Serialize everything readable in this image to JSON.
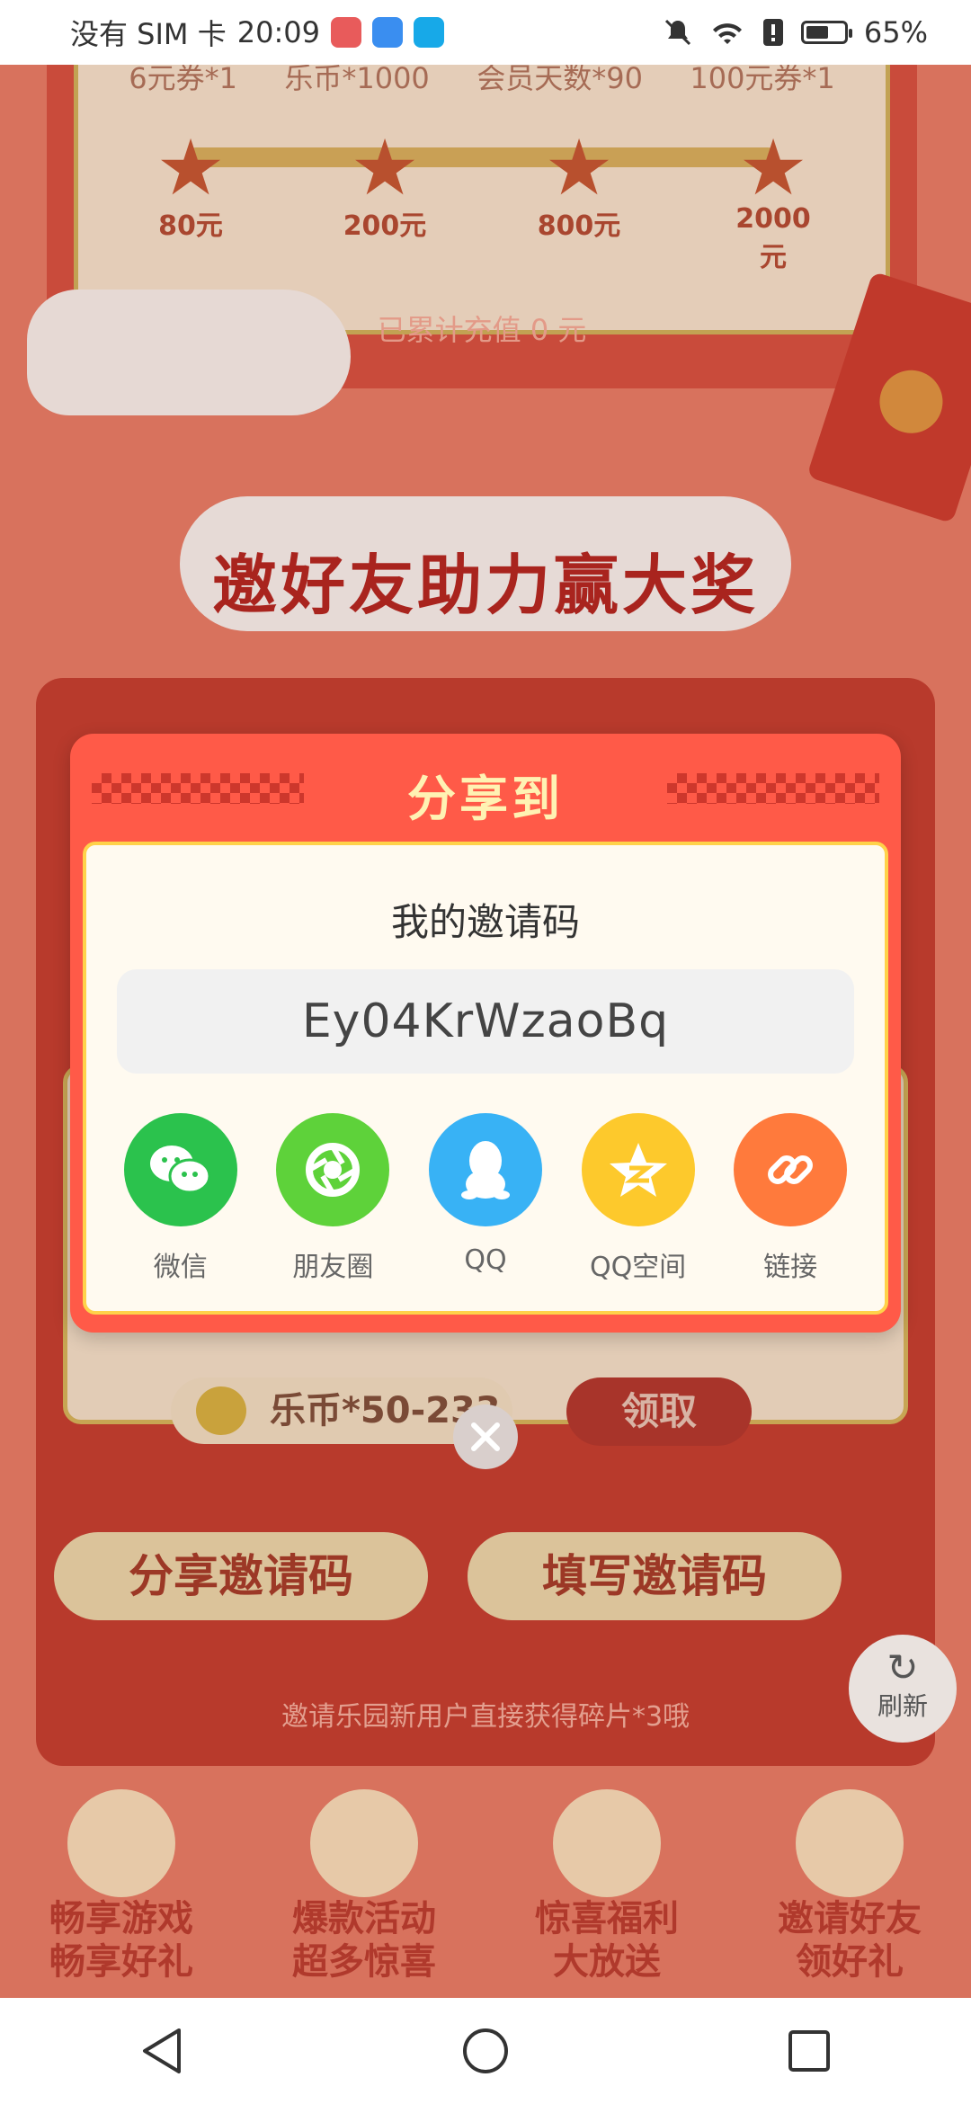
{
  "status_bar": {
    "carrier": "没有 SIM 卡",
    "time": "20:09",
    "battery_percent": "65%",
    "battery_level": 0.65
  },
  "background": {
    "tiers": [
      "6元券*1",
      "乐币*1000",
      "会员天数*90",
      "100元券*1"
    ],
    "milestones": [
      "80元",
      "200元",
      "800元",
      "2000元"
    ],
    "accumulated": "已累计充值 0 元",
    "section_title": "邀好友助力赢大奖",
    "reward_pill": "乐币*50-233",
    "claim_label": "领取",
    "share_code_button": "分享邀请码",
    "fill_code_button": "填写邀请码",
    "hint": "邀请乐园新用户直接获得碎片*3哦",
    "refresh_label": "刷新",
    "features": [
      {
        "line1": "畅享游戏",
        "line2": "畅享好礼"
      },
      {
        "line1": "爆款活动",
        "line2": "超多惊喜"
      },
      {
        "line1": "惊喜福利",
        "line2": "大放送"
      },
      {
        "line1": "邀请好友",
        "line2": "领好礼"
      }
    ]
  },
  "modal": {
    "title": "分享到",
    "invite_label": "我的邀请码",
    "invite_code": "Ey04KrWzaoBq",
    "share_targets": [
      {
        "label": "微信",
        "icon": "wechat-icon",
        "color": "#2bc24d"
      },
      {
        "label": "朋友圈",
        "icon": "moments-icon",
        "color": "#5ed23a"
      },
      {
        "label": "QQ",
        "icon": "qq-icon",
        "color": "#38b2f5"
      },
      {
        "label": "QQ空间",
        "icon": "qzone-icon",
        "color": "#fdc92c"
      },
      {
        "label": "链接",
        "icon": "link-icon",
        "color": "#ff7a3c"
      }
    ]
  },
  "colors": {
    "modal_header": "#ff5a48",
    "modal_body": "#fffaf0",
    "title_text": "#fff2b3"
  }
}
